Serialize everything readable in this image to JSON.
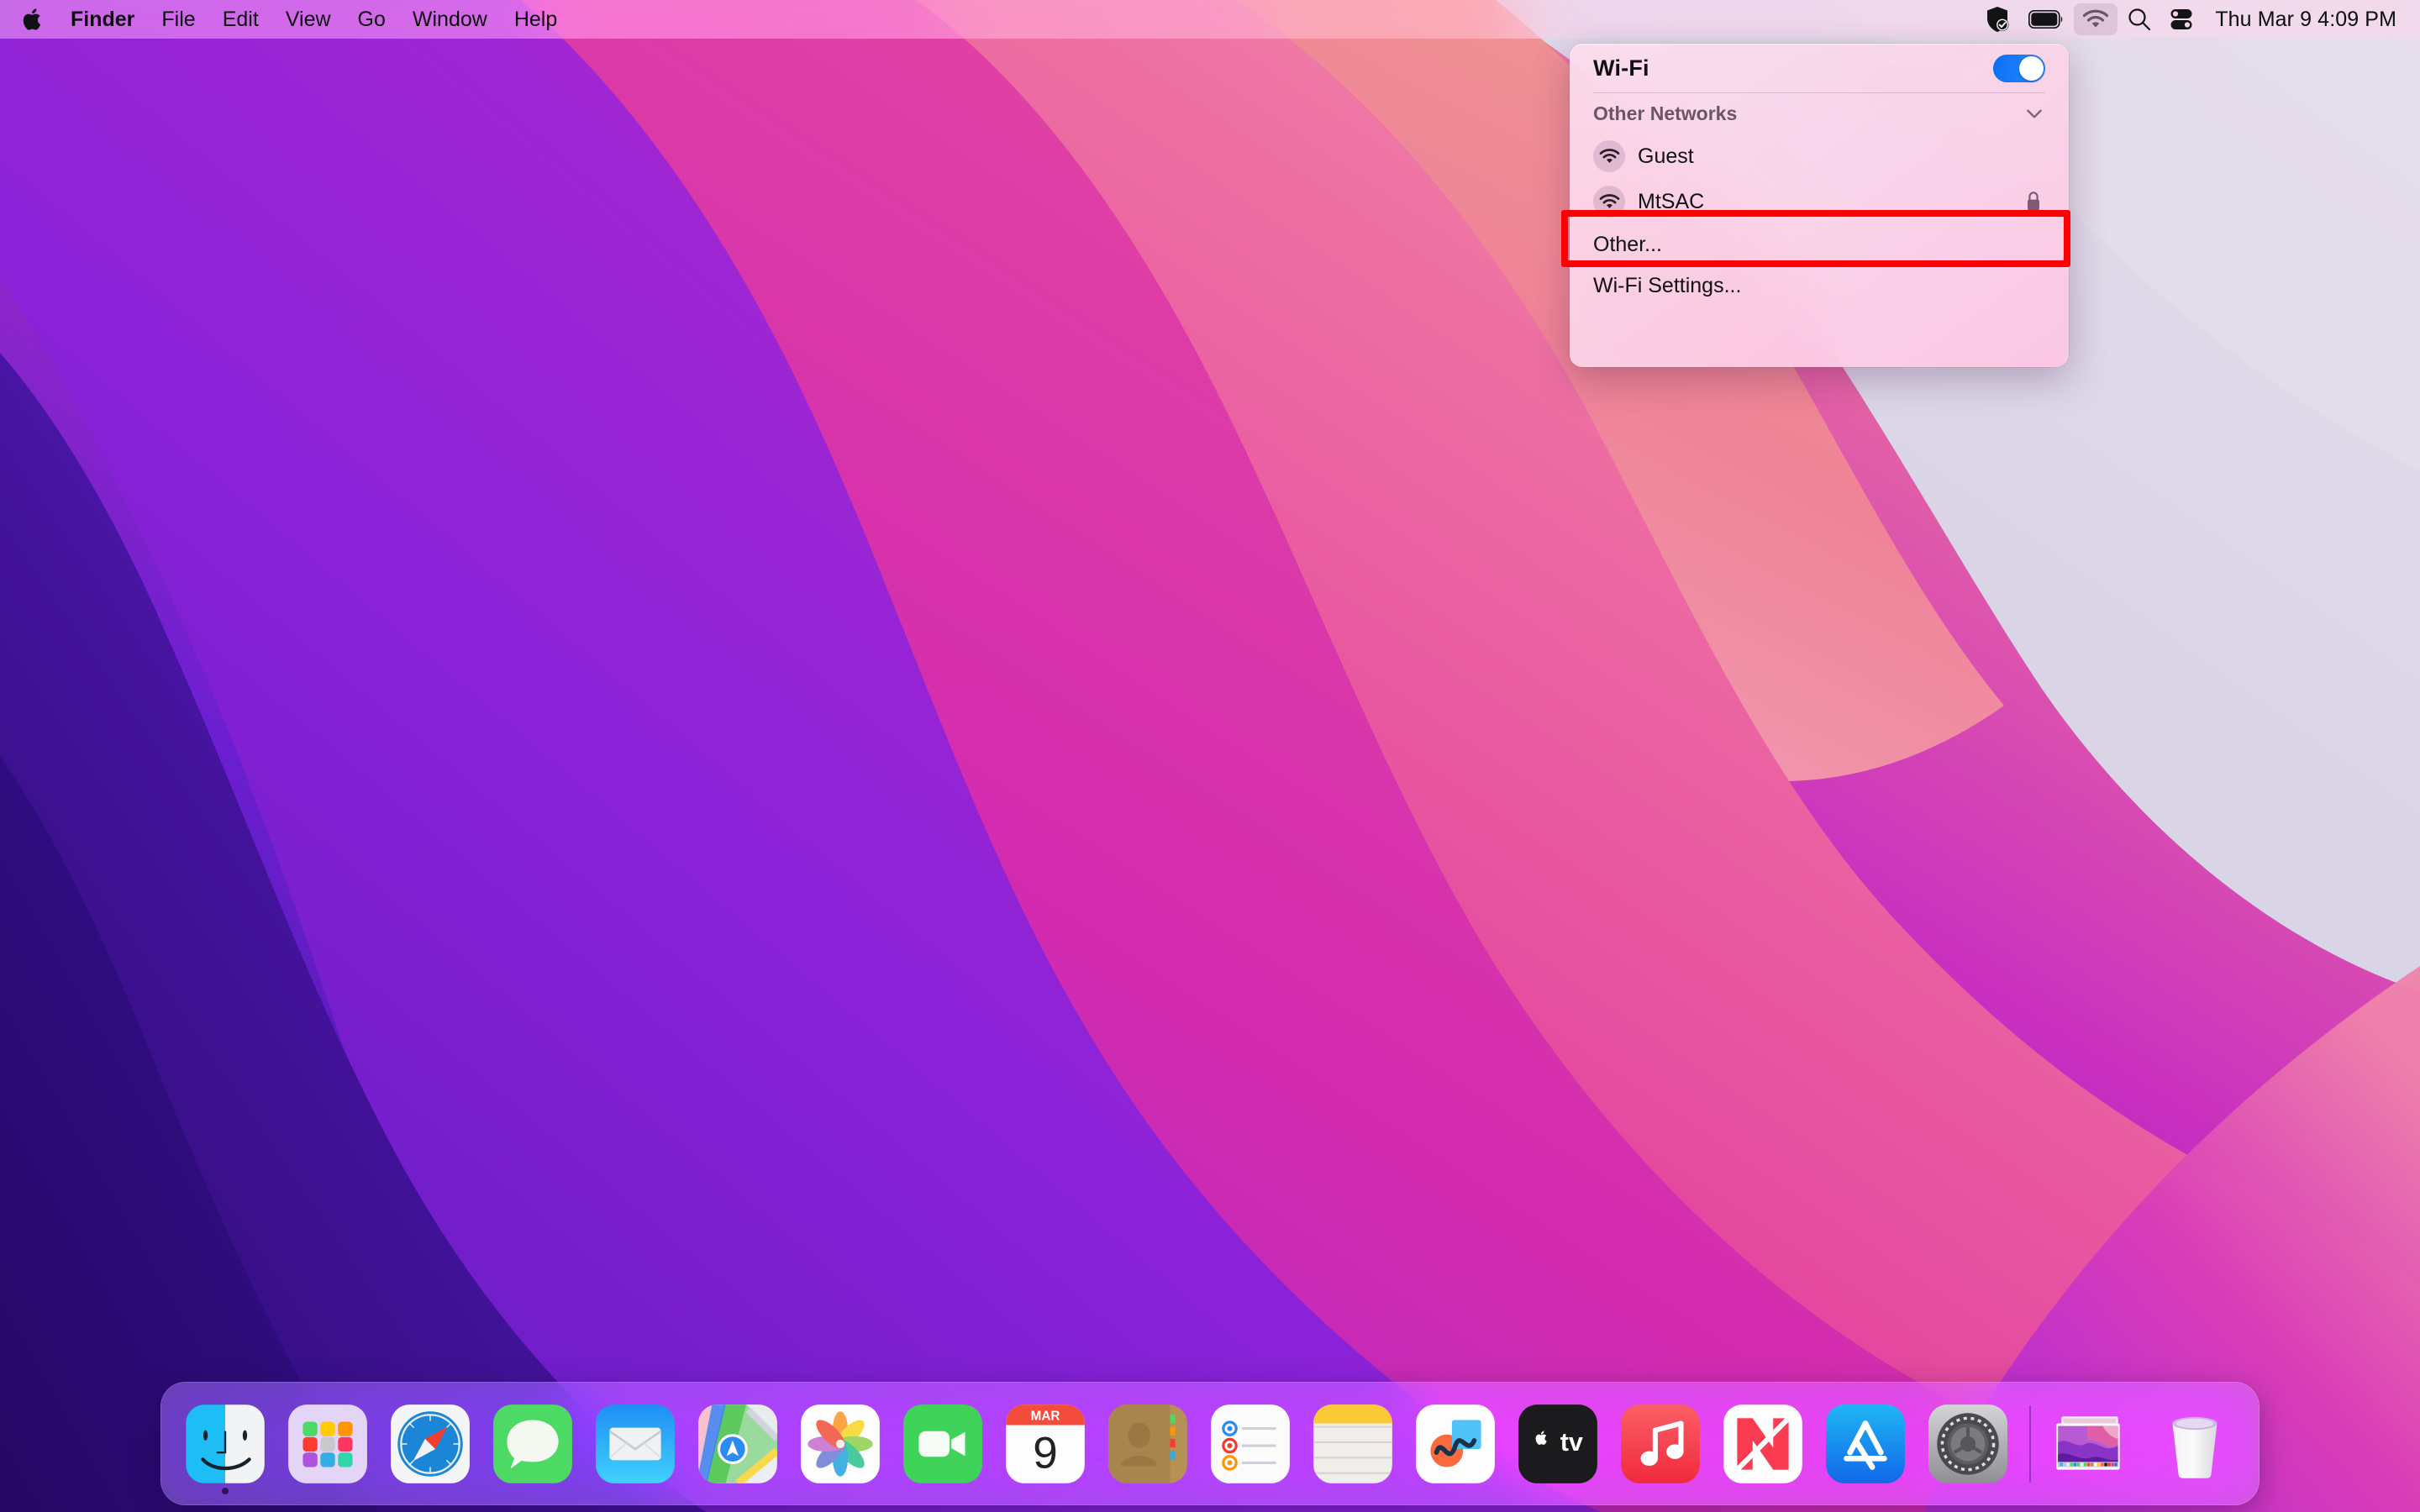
{
  "menubar": {
    "apple_icon": "apple-logo-icon",
    "items": [
      {
        "label": "Finder",
        "bold": true
      },
      {
        "label": "File",
        "bold": false
      },
      {
        "label": "Edit",
        "bold": false
      },
      {
        "label": "View",
        "bold": false
      },
      {
        "label": "Go",
        "bold": false
      },
      {
        "label": "Window",
        "bold": false
      },
      {
        "label": "Help",
        "bold": false
      }
    ],
    "status_icons": [
      {
        "name": "shield-check-icon",
        "active": false
      },
      {
        "name": "battery-icon",
        "active": false
      },
      {
        "name": "wifi-icon",
        "active": true
      },
      {
        "name": "search-icon",
        "active": false
      },
      {
        "name": "control-center-icon",
        "active": false
      }
    ],
    "clock": "Thu Mar 9  4:09 PM"
  },
  "wifi_panel": {
    "title": "Wi-Fi",
    "toggle_on": true,
    "toggle_color": "#0a6ff5",
    "section_label": "Other Networks",
    "chevron_icon": "chevron-down-icon",
    "networks": [
      {
        "name": "Guest",
        "secured": false,
        "highlighted": false
      },
      {
        "name": "MtSAC",
        "secured": true,
        "highlighted": true
      }
    ],
    "other_label": "Other...",
    "settings_label": "Wi-Fi Settings...",
    "highlight_color": "#ff0000"
  },
  "dock": {
    "items": [
      {
        "label": "Finder",
        "icon": "finder-icon",
        "running": true
      },
      {
        "label": "Launchpad",
        "icon": "launchpad-icon",
        "running": false
      },
      {
        "label": "Safari",
        "icon": "safari-icon",
        "running": false
      },
      {
        "label": "Messages",
        "icon": "messages-icon",
        "running": false
      },
      {
        "label": "Mail",
        "icon": "mail-icon",
        "running": false
      },
      {
        "label": "Maps",
        "icon": "maps-icon",
        "running": false
      },
      {
        "label": "Photos",
        "icon": "photos-icon",
        "running": false
      },
      {
        "label": "FaceTime",
        "icon": "facetime-icon",
        "running": false
      },
      {
        "label": "Calendar",
        "icon": "calendar-icon",
        "running": false,
        "month": "MAR",
        "day": "9"
      },
      {
        "label": "Contacts",
        "icon": "contacts-icon",
        "running": false
      },
      {
        "label": "Reminders",
        "icon": "reminders-icon",
        "running": false
      },
      {
        "label": "Notes",
        "icon": "notes-icon",
        "running": false
      },
      {
        "label": "Freeform",
        "icon": "freeform-icon",
        "running": false
      },
      {
        "label": "TV",
        "icon": "appletv-icon",
        "running": false
      },
      {
        "label": "Music",
        "icon": "music-icon",
        "running": false
      },
      {
        "label": "News",
        "icon": "news-icon",
        "running": false
      },
      {
        "label": "App Store",
        "icon": "appstore-icon",
        "running": false
      },
      {
        "label": "System Settings",
        "icon": "system-settings-icon",
        "running": false
      }
    ],
    "minimized_window": {
      "label": "Minimized window",
      "icon": "window-thumbnail-icon"
    },
    "trash": {
      "label": "Trash",
      "icon": "trash-icon"
    }
  },
  "wallpaper": {
    "name": "macOS Monterey",
    "colors": [
      "#6d1fd4",
      "#4a17a8",
      "#9b24c9",
      "#d32bb0",
      "#e84f9e",
      "#ef7d9a",
      "#f0b7cf",
      "#d6d3e6"
    ]
  }
}
